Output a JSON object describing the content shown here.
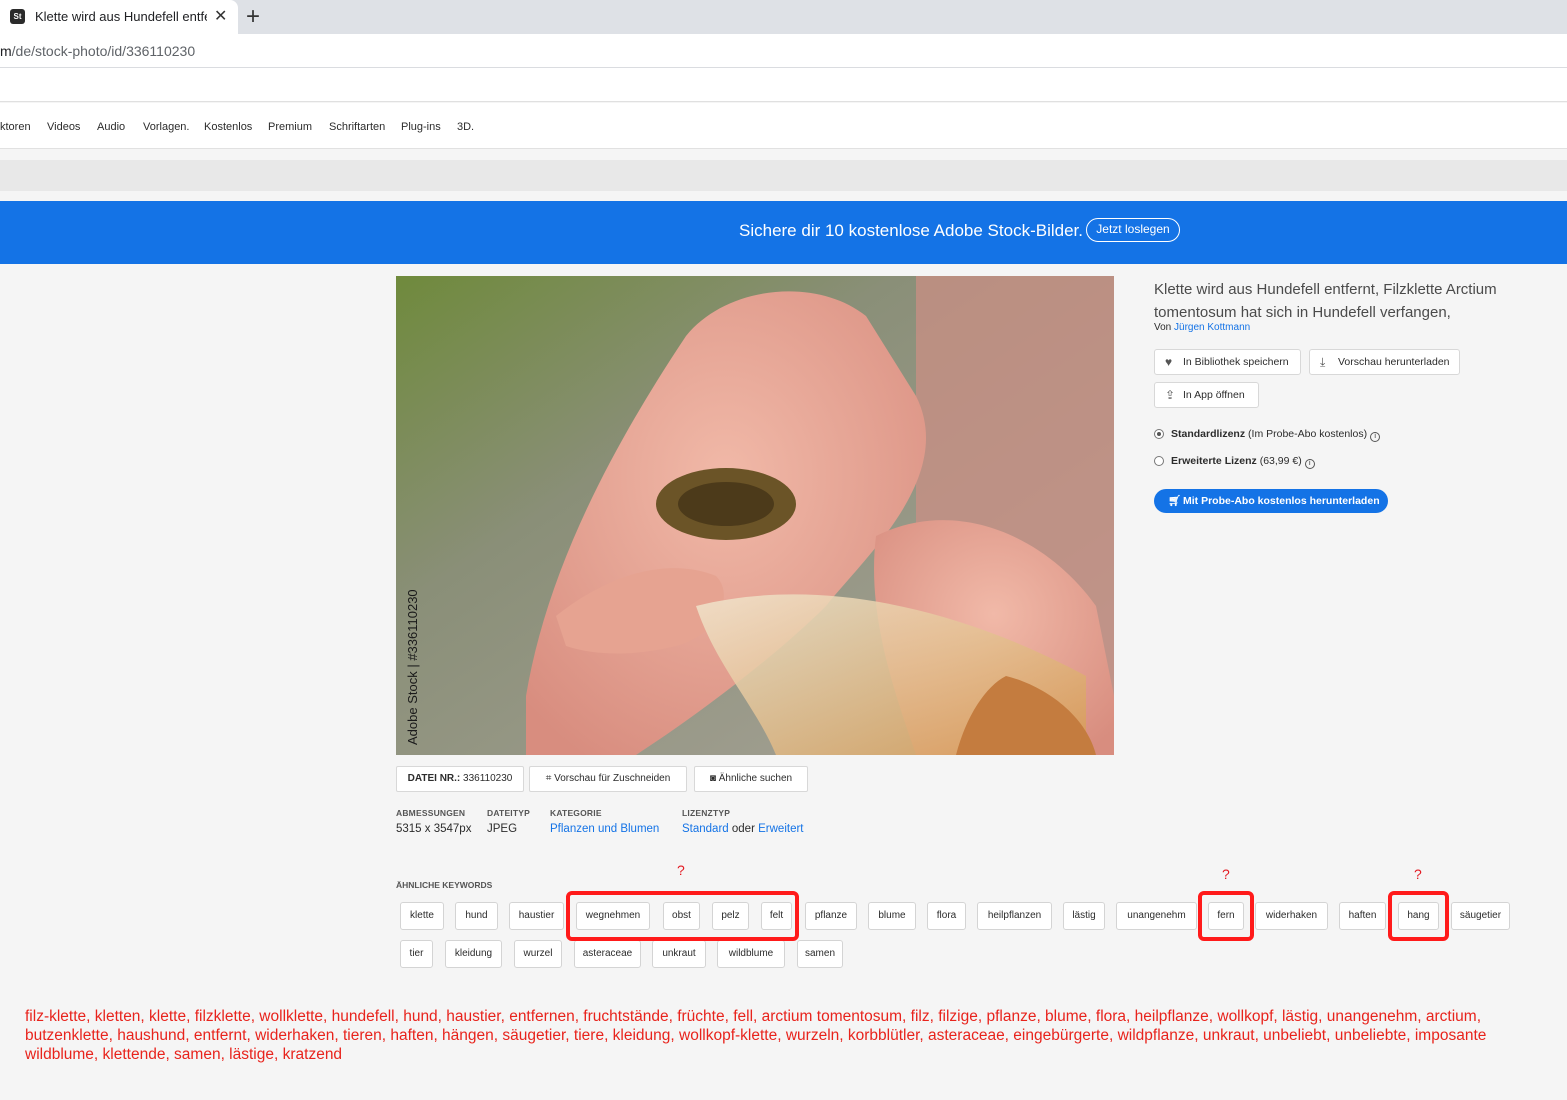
{
  "browser": {
    "tab_title": "Klette wird aus Hundefell entferr",
    "tab_favicon": "St",
    "url_prefix": "m",
    "url_path": "/de/stock-photo/id/336110230"
  },
  "nav": {
    "items": [
      "ktoren",
      "Videos",
      "Audio",
      "Vorlagen.",
      "Kostenlos",
      "Premium",
      "Schriftarten",
      "Plug-ins",
      "3D."
    ]
  },
  "banner": {
    "text": "Sichere dir 10 kostenlose Adobe Stock-Bilder.",
    "button": "Jetzt loslegen"
  },
  "photo": {
    "watermark_side": "Adobe Stock | #336110230",
    "watermark_diag": "Adobe Stock"
  },
  "asset": {
    "title": "Klette wird aus Hundefell entfernt, Filzklette Arctium tomentosum hat sich in Hundefell verfangen,",
    "author_prefix": "Von",
    "author": "Jürgen Kottmann",
    "save_button": "In Bibliothek speichern",
    "preview_button": "Vorschau herunterladen",
    "open_app_button": "In App öffnen",
    "license_standard": "Standardlizenz",
    "license_standard_note": "(Im Probe-Abo kostenlos)",
    "license_extended": "Erweiterte Lizenz",
    "license_extended_note": "(63,99 €)",
    "license_selected": "standard",
    "download_button": "Mit Probe-Abo kostenlos herunterladen"
  },
  "details": {
    "file_label": "DATEI NR.:",
    "file_number": "336110230",
    "crop_button": "Vorschau für Zuschneiden",
    "similar_button": "Ähnliche suchen",
    "dimensions_label": "ABMESSUNGEN",
    "dimensions": "5315 x 3547px",
    "filetype_label": "DATEITYP",
    "filetype": "JPEG",
    "category_label": "KATEGORIE",
    "category": "Pflanzen und Blumen",
    "licensetype_label": "LIZENZTYP",
    "licensetype_standard": "Standard",
    "licensetype_or": "oder",
    "licensetype_extended": "Erweitert"
  },
  "keywords": {
    "label": "ÄHNLICHE KEYWORDS",
    "row1": [
      "klette",
      "hund",
      "haustier",
      "wegnehmen",
      "obst",
      "pelz",
      "felt",
      "pflanze",
      "blume",
      "flora",
      "heilpflanzen",
      "lästig",
      "unangenehm",
      "fern",
      "widerhaken",
      "haften",
      "hang",
      "säugetier"
    ],
    "row2": [
      "tier",
      "kleidung",
      "wurzel",
      "asteraceae",
      "unkraut",
      "wildblume",
      "samen"
    ]
  },
  "annotations": {
    "question_mark": "?",
    "highlight_color": "#ff1a1a",
    "keyword_list": "filz-klette, kletten, klette, filzklette, wollklette, hundefell, hund, haustier, entfernen, fruchtstände, früchte, fell, arctium tomentosum, filz, filzige, pflanze, blume, flora, heilpflanze, wollkopf, lästig, unangenehm, arctium, butzenklette, haushund, entfernt, widerhaken, tieren, haften, hängen, säugetier, tiere, kleidung, wollkopf-klette, wurzeln, korbblütler, asteraceae, eingebürgerte, wildpflanze, unkraut, unbeliebt, unbeliebte, imposante wildblume, klettende, samen, lästige, kratzend"
  },
  "colors": {
    "accent": "#1473e6",
    "annotation_red": "#e8231c"
  }
}
